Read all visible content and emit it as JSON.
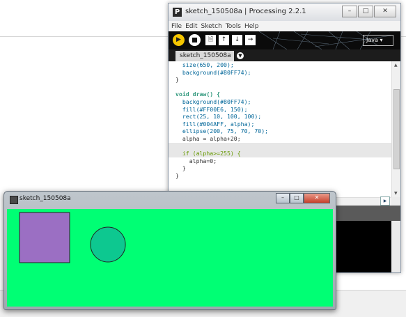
{
  "ide": {
    "title": "sketch_150508a | Processing 2.2.1",
    "menu": [
      "File",
      "Edit",
      "Sketch",
      "Tools",
      "Help"
    ],
    "mode": "Java",
    "tab": "sketch_150508a",
    "code": [
      "  size(650, 200);",
      "  background(#80FF74);",
      "}",
      "",
      "void draw() {",
      "  background(#80FF74);",
      "  fill(#FF00E6, 150);",
      "  rect(25, 10, 100, 100);",
      "  fill(#004AFF, alpha);",
      "  ellipse(200, 75, 70, 70);",
      "  alpha = alpha+20;",
      "",
      "  if (alpha>=255) {",
      "    alpha=0;",
      "  }",
      "}"
    ],
    "highlighted_line": 12
  },
  "sketch": {
    "title": "sketch_150508a",
    "background_color": "#00FF74",
    "rect_color": "#9B6FC3",
    "ellipse_color": "#0DC890"
  }
}
